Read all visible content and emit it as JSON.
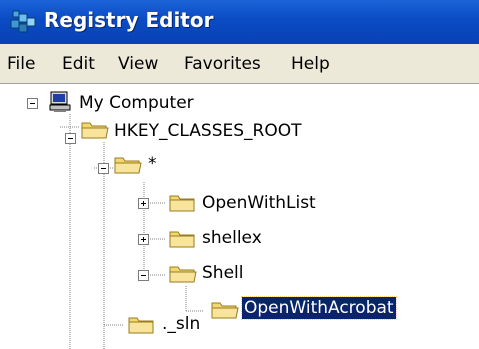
{
  "window": {
    "title": "Registry Editor"
  },
  "menu": {
    "file": "File",
    "edit": "Edit",
    "view": "View",
    "favorites": "Favorites",
    "help": "Help"
  },
  "tree": {
    "my_computer": "My Computer",
    "hkcr": "HKEY_CLASSES_ROOT",
    "star": "*",
    "openwithlist": "OpenWithList",
    "shellex": "shellex",
    "shell": "Shell",
    "openwithacrobat": "OpenWithAcrobat",
    "sln": "._sln"
  },
  "icons": {
    "app": "registry-editor-icon",
    "computer": "computer-icon",
    "folder": "folder-icon",
    "folder_open": "folder-open-icon"
  },
  "colors": {
    "titlebar": "#0a4bc4",
    "selection": "#0a246a",
    "folder": "#f3d772"
  }
}
